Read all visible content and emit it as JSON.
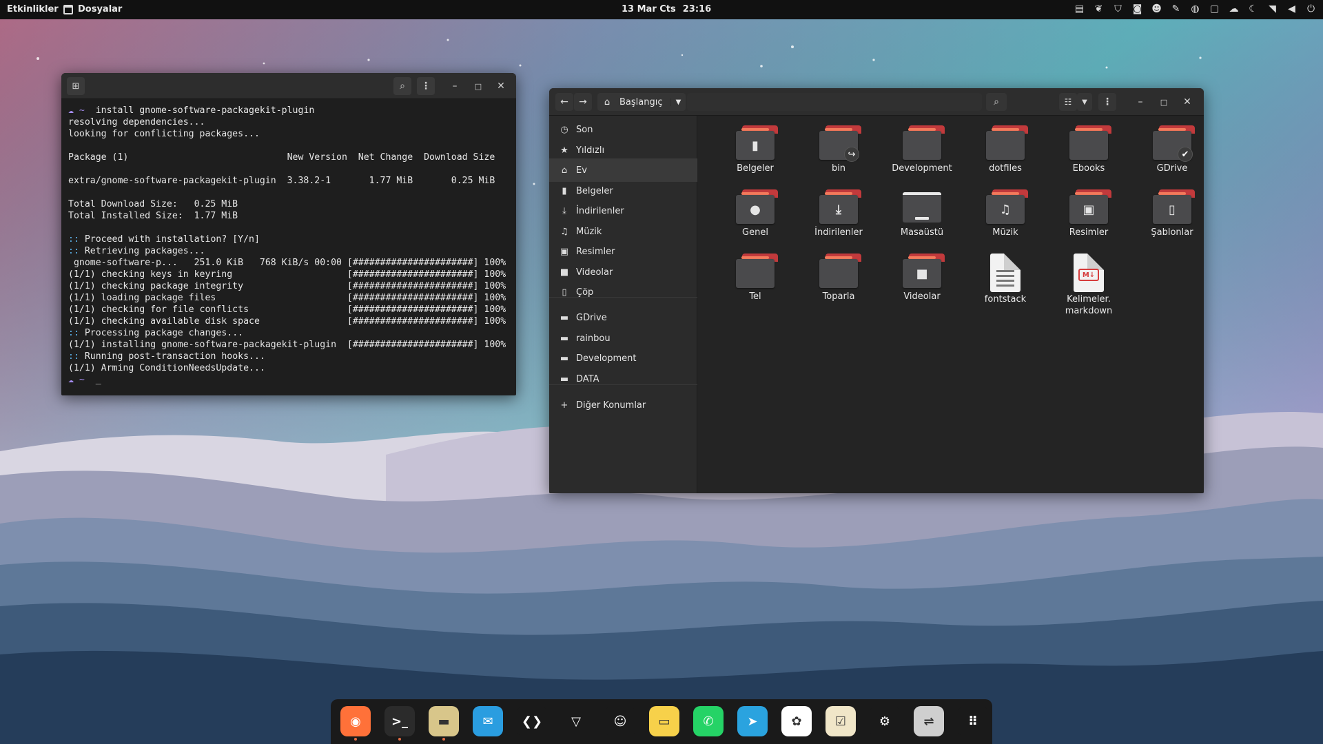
{
  "topbar": {
    "activities": "Etkinlikler",
    "app_menu": "Dosyalar",
    "date": "13 Mar Cts",
    "time": "23:16",
    "tray_icons": [
      "display-icon",
      "leaf-icon",
      "shield-icon",
      "camera-icon",
      "face-icon",
      "pen-icon",
      "steam-icon",
      "clipboard-icon",
      "cloud-icon",
      "night-light-icon",
      "wifi-icon",
      "volume-icon",
      "power-icon"
    ]
  },
  "terminal": {
    "lines": [
      {
        "p": "☁ ~ ",
        "t": " install gnome-software-packagekit-plugin"
      },
      {
        "p": "",
        "t": "resolving dependencies..."
      },
      {
        "p": "",
        "t": "looking for conflicting packages..."
      },
      {
        "p": "",
        "t": ""
      },
      {
        "p": "",
        "t": "Package (1)                             New Version  Net Change  Download Size"
      },
      {
        "p": "",
        "t": ""
      },
      {
        "p": "",
        "t": "extra/gnome-software-packagekit-plugin  3.38.2-1       1.77 MiB       0.25 MiB"
      },
      {
        "p": "",
        "t": ""
      },
      {
        "p": "",
        "t": "Total Download Size:   0.25 MiB"
      },
      {
        "p": "",
        "t": "Total Installed Size:  1.77 MiB"
      },
      {
        "p": "",
        "t": ""
      },
      {
        "p": ":: ",
        "t": "Proceed with installation? [Y/n]"
      },
      {
        "p": ":: ",
        "t": "Retrieving packages..."
      },
      {
        "p": "",
        "t": " gnome-software-p...   251.0 KiB   768 KiB/s 00:00 [######################] 100%"
      },
      {
        "p": "",
        "t": "(1/1) checking keys in keyring                     [######################] 100%"
      },
      {
        "p": "",
        "t": "(1/1) checking package integrity                   [######################] 100%"
      },
      {
        "p": "",
        "t": "(1/1) loading package files                        [######################] 100%"
      },
      {
        "p": "",
        "t": "(1/1) checking for file conflicts                  [######################] 100%"
      },
      {
        "p": "",
        "t": "(1/1) checking available disk space                [######################] 100%"
      },
      {
        "p": ":: ",
        "t": "Processing package changes..."
      },
      {
        "p": "",
        "t": "(1/1) installing gnome-software-packagekit-plugin  [######################] 100%"
      },
      {
        "p": ":: ",
        "t": "Running post-transaction hooks..."
      },
      {
        "p": "",
        "t": "(1/1) Arming ConditionNeedsUpdate..."
      },
      {
        "p": "☁ ~ ",
        "t": " _"
      }
    ]
  },
  "files": {
    "path_label": "Başlangıç",
    "sidebar": [
      {
        "label": "Son",
        "icon": "clock-icon",
        "glyph": "◷"
      },
      {
        "label": "Yıldızlı",
        "icon": "star-icon",
        "glyph": "★"
      },
      {
        "label": "Ev",
        "icon": "home-icon",
        "glyph": "⌂"
      },
      {
        "label": "Belgeler",
        "icon": "document-icon",
        "glyph": "▮"
      },
      {
        "label": "İndirilenler",
        "icon": "download-icon",
        "glyph": "⤓"
      },
      {
        "label": "Müzik",
        "icon": "music-icon",
        "glyph": "♫"
      },
      {
        "label": "Resimler",
        "icon": "image-icon",
        "glyph": "▣"
      },
      {
        "label": "Videolar",
        "icon": "video-icon",
        "glyph": "■"
      },
      {
        "label": "Çöp",
        "icon": "trash-icon",
        "glyph": "▯"
      },
      {
        "label": "GDrive",
        "icon": "folder-icon",
        "glyph": "▬"
      },
      {
        "label": "rainbou",
        "icon": "folder-icon",
        "glyph": "▬"
      },
      {
        "label": "Development",
        "icon": "folder-icon",
        "glyph": "▬"
      },
      {
        "label": "DATA",
        "icon": "folder-icon",
        "glyph": "▬"
      },
      {
        "label": "Diğer Konumlar",
        "icon": "plus-icon",
        "glyph": "+"
      }
    ],
    "items": [
      {
        "label": "Belgeler",
        "kind": "folder",
        "emblem": "▮",
        "icon": "documents-folder-icon"
      },
      {
        "label": "bin",
        "kind": "folder",
        "emblem": "",
        "badge": "↪",
        "icon": "bin-folder-icon"
      },
      {
        "label": "Development",
        "kind": "folder",
        "emblem": "",
        "icon": "folder-icon"
      },
      {
        "label": "dotfiles",
        "kind": "folder",
        "emblem": "",
        "icon": "folder-icon"
      },
      {
        "label": "Ebooks",
        "kind": "folder",
        "emblem": "",
        "icon": "folder-icon"
      },
      {
        "label": "GDrive",
        "kind": "folder",
        "emblem": "",
        "badge": "✔",
        "icon": "gdrive-folder-icon"
      },
      {
        "label": "Genel",
        "kind": "folder",
        "emblem": "●",
        "icon": "public-folder-icon"
      },
      {
        "label": "İndirilenler",
        "kind": "folder",
        "emblem": "⤓",
        "icon": "downloads-folder-icon"
      },
      {
        "label": "Masaüstü",
        "kind": "desktop",
        "emblem": "",
        "icon": "desktop-folder-icon"
      },
      {
        "label": "Müzik",
        "kind": "folder",
        "emblem": "♫",
        "icon": "music-folder-icon"
      },
      {
        "label": "Resimler",
        "kind": "folder",
        "emblem": "▣",
        "icon": "pictures-folder-icon"
      },
      {
        "label": "Şablonlar",
        "kind": "folder",
        "emblem": "▯",
        "icon": "templates-folder-icon"
      },
      {
        "label": "Tel",
        "kind": "folder",
        "emblem": "",
        "icon": "folder-icon"
      },
      {
        "label": "Toparla",
        "kind": "folder",
        "emblem": "",
        "icon": "folder-icon"
      },
      {
        "label": "Videolar",
        "kind": "folder",
        "emblem": "■",
        "icon": "videos-folder-icon"
      },
      {
        "label": "fontstack",
        "kind": "text",
        "emblem": "",
        "icon": "text-file-icon"
      },
      {
        "label": "Kelimeler.\nmarkdown",
        "kind": "markdown",
        "emblem": "M↓",
        "icon": "markdown-file-icon"
      }
    ]
  },
  "dock": [
    {
      "name": "firefox-icon",
      "bg": "#ff7139",
      "glyph": "◉",
      "running": true
    },
    {
      "name": "terminal-icon",
      "bg": "#2b2b2b",
      "glyph": ">_",
      "running": true
    },
    {
      "name": "files-icon",
      "bg": "#d8c68a",
      "glyph": "▬",
      "running": true
    },
    {
      "name": "mail-icon",
      "bg": "#2a9de0",
      "glyph": "✉",
      "running": false
    },
    {
      "name": "vscode-icon",
      "bg": "#1a1a1a",
      "glyph": "❮❯",
      "running": false
    },
    {
      "name": "protonvpn-icon",
      "bg": "#1a1a1a",
      "glyph": "▽",
      "running": false
    },
    {
      "name": "avatar-icon",
      "bg": "#1a1a1a",
      "glyph": "☺",
      "running": false
    },
    {
      "name": "notes-icon",
      "bg": "#f7d14a",
      "glyph": "▭",
      "running": false
    },
    {
      "name": "whatsapp-icon",
      "bg": "#25d366",
      "glyph": "✆",
      "running": false
    },
    {
      "name": "telegram-icon",
      "bg": "#2aa3df",
      "glyph": "➤",
      "running": false
    },
    {
      "name": "photos-icon",
      "bg": "#ffffff",
      "glyph": "✿",
      "running": false
    },
    {
      "name": "tasks-icon",
      "bg": "#f0e6c8",
      "glyph": "☑",
      "running": false
    },
    {
      "name": "steam-icon",
      "bg": "#1a1a1a",
      "glyph": "⚙",
      "running": false
    },
    {
      "name": "tweaks-icon",
      "bg": "#cfcfcf",
      "glyph": "⇌",
      "running": false
    },
    {
      "name": "app-grid-icon",
      "bg": "#1a1a1a",
      "glyph": "⠿",
      "running": false
    }
  ]
}
